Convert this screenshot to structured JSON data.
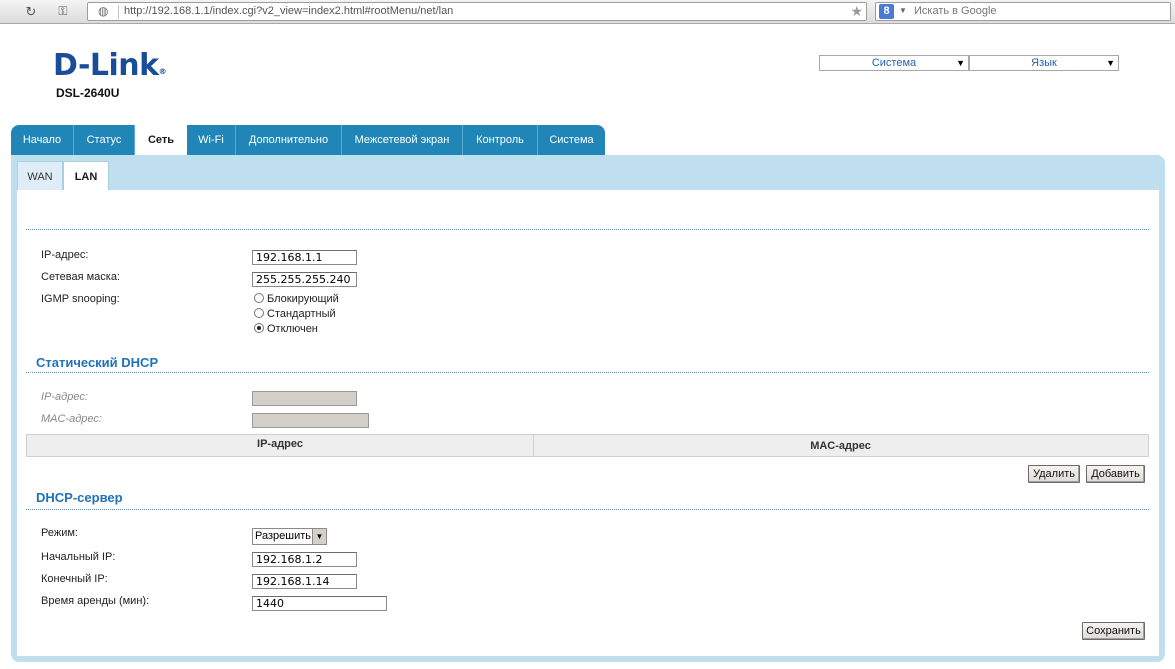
{
  "browser": {
    "url": "http://192.168.1.1/index.cgi?v2_view=index2.html#rootMenu/net/lan",
    "search_placeholder": "Искать в Google",
    "search_engine_letter": "8"
  },
  "header": {
    "logo": "D-Link",
    "model": "DSL-2640U",
    "system_select": "Система",
    "language_select": "Язык"
  },
  "main_tabs": [
    "Начало",
    "Статус",
    "Сеть",
    "Wi-Fi",
    "Дополнительно",
    "Межсетевой экран",
    "Контроль",
    "Система"
  ],
  "active_main_tab": "Сеть",
  "sub_tabs": [
    "WAN",
    "LAN"
  ],
  "active_sub_tab": "LAN",
  "lan": {
    "ip_label": "IP-адрес:",
    "ip_value": "192.168.1.1",
    "mask_label": "Сетевая маска:",
    "mask_value": "255.255.255.240",
    "igmp_label": "IGMP snooping:",
    "igmp_options": [
      "Блокирующий",
      "Стандартный",
      "Отключен"
    ],
    "igmp_selected": "Отключен"
  },
  "static_dhcp": {
    "title": "Статический DHCP",
    "ip_label": "IP-адрес:",
    "mac_label": "MAC-адрес:",
    "col_ip": "IP-адрес",
    "col_mac": "MAC-адрес",
    "delete_button": "Удалить",
    "add_button": "Добавить"
  },
  "dhcp_server": {
    "title": "DHCP-сервер",
    "mode_label": "Режим:",
    "mode_value": "Разрешить",
    "start_label": "Начальный IP:",
    "start_value": "192.168.1.2",
    "end_label": "Конечный IP:",
    "end_value": "192.168.1.14",
    "lease_label": "Время аренды (мин):",
    "lease_value": "1440",
    "save_button": "Сохранить"
  }
}
